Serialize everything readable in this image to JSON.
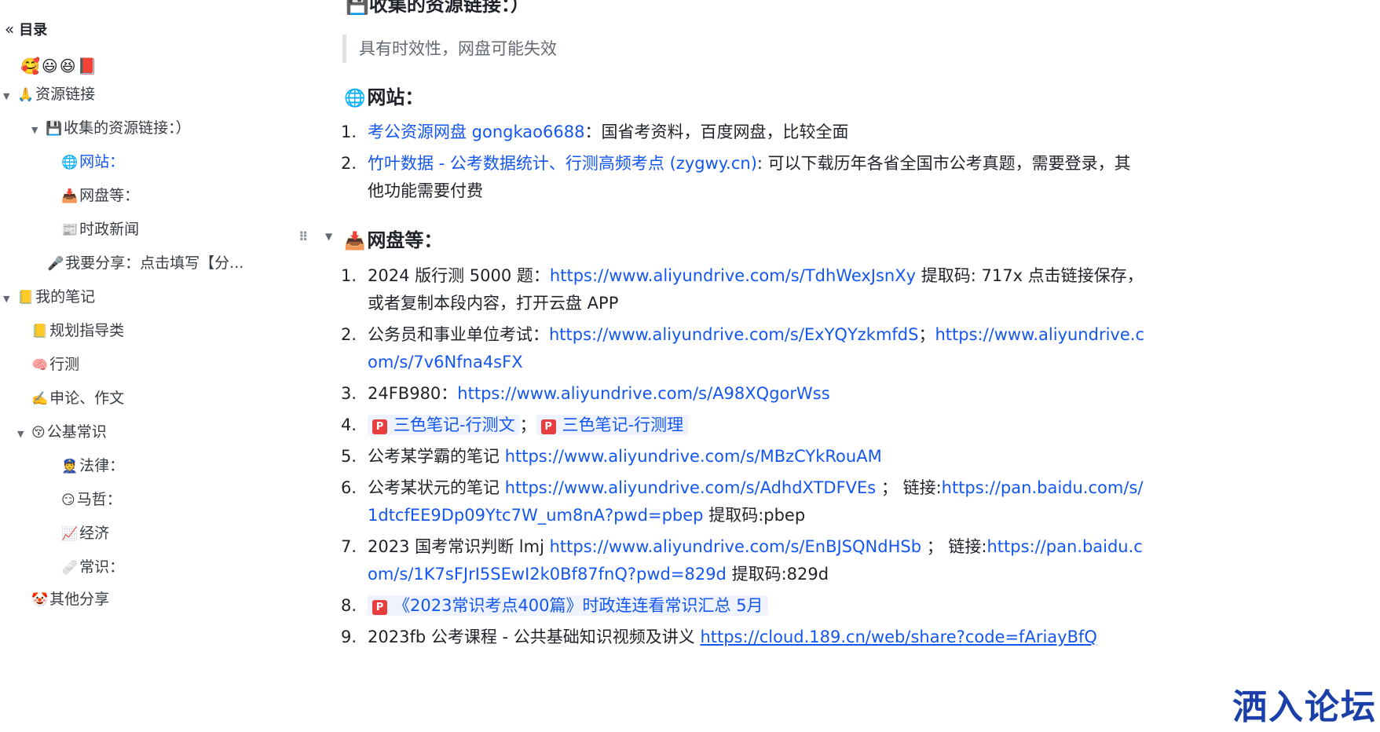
{
  "toc": {
    "title": "目录",
    "emojis": "🥰😃😆📕",
    "items": [
      {
        "icon": "🙏",
        "label": "资源链接"
      },
      {
        "icon": "💾",
        "label": "收集的资源链接：）"
      },
      {
        "icon": "🌐",
        "label": "网站："
      },
      {
        "icon": "📥",
        "label": "网盘等："
      },
      {
        "icon": "📰",
        "label": "时政新闻"
      },
      {
        "icon": "🎤",
        "label": "我要分享：点击填写【分..."
      },
      {
        "icon": "📒",
        "label": "我的笔记"
      },
      {
        "icon": "📒",
        "label": "规划指导类"
      },
      {
        "icon": "🧠",
        "label": "行测"
      },
      {
        "icon": "✍️",
        "label": "申论、作文"
      },
      {
        "icon": "😚",
        "label": "公基常识"
      },
      {
        "icon": "👮",
        "label": "法律："
      },
      {
        "icon": "😏",
        "label": "马哲："
      },
      {
        "icon": "📈",
        "label": "经济"
      },
      {
        "icon": "🩹",
        "label": "常识："
      },
      {
        "icon": "🤡",
        "label": "其他分享"
      }
    ]
  },
  "content": {
    "top_heading": "💾收集的资源链接：）",
    "quote": "具有时效性，网盘可能失效",
    "websites": {
      "icon": "🌐",
      "title": "网站：",
      "items": [
        {
          "num": "1.",
          "link": "考公资源网盘 gongkao6688",
          "text": "：国省考资料，百度网盘，比较全面"
        },
        {
          "num": "2.",
          "link": "竹叶数据 - 公考数据统计、行测高频考点 (zygwy.cn)",
          "text": ": 可以下载历年各省全国市公考真题，需要登录，其他功能需要付费"
        }
      ]
    },
    "netdisk": {
      "icon": "📥",
      "title": "网盘等：",
      "items": [
        {
          "num": "1.",
          "pre": "2024 版行测 5000 题：",
          "link1": "https://www.aliyundrive.com/s/TdhWexJsnXy",
          "post": " 提取码: 717x 点击链接保存，或者复制本段内容，打开云盘 APP"
        },
        {
          "num": "2.",
          "pre": "公务员和事业单位考试：",
          "link1": "https://www.aliyundrive.com/s/ExYQYzkmfdS",
          "mid": "；",
          "link2": "https://www.aliyundrive.com/s/7v6Nfna4sFX"
        },
        {
          "num": "3.",
          "pre": "24FB980：",
          "link1": "https://www.aliyundrive.com/s/A98XQgorWss"
        },
        {
          "num": "4.",
          "card1": "三色笔记-行测文",
          "mid": "；",
          "card2": "三色笔记-行测理"
        },
        {
          "num": "5.",
          "pre": "公考某学霸的笔记 ",
          "link1": "https://www.aliyundrive.com/s/MBzCYkRouAM"
        },
        {
          "num": "6.",
          "pre": "公考某状元的笔记 ",
          "link1": "https://www.aliyundrive.com/s/AdhdXTDFVEs",
          "mid": " ； 链接:",
          "link2": "https://pan.baidu.com/s/1dtcfEE9Dp09Ytc7W_um8nA?pwd=pbep",
          "post": " 提取码:pbep"
        },
        {
          "num": "7.",
          "pre": "2023 国考常识判断 lmj ",
          "link1": "https://www.aliyundrive.com/s/EnBJSQNdHSb",
          "mid": " ； 链接:",
          "link2": "https://pan.baidu.com/s/1K7sFJrI5SEwI2k0Bf87fnQ?pwd=829d",
          "post": " 提取码:829d"
        },
        {
          "num": "8.",
          "card1": "《2023常识考点400篇》时政连连看常识汇总 5月"
        },
        {
          "num": "9.",
          "pre": "2023fb 公考课程 - 公共基础知识视频及讲义 ",
          "link1": "https://cloud.189.cn/web/share?code=fAriayBfQ"
        }
      ]
    }
  },
  "watermark": "洒入论坛"
}
